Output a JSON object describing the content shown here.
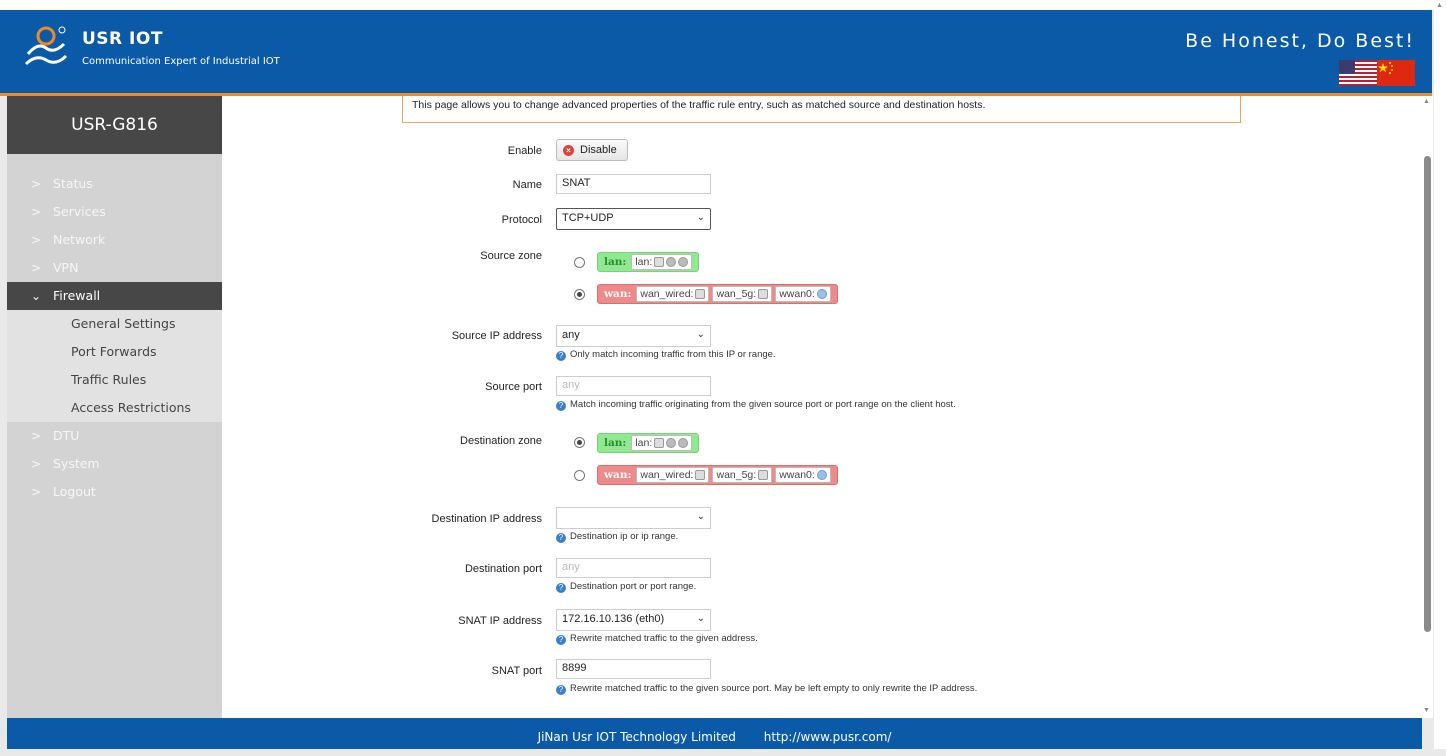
{
  "header": {
    "logo_title": "USR IOT",
    "logo_subtitle": "Communication Expert of Industrial IOT",
    "slogan": "Be Honest, Do Best!",
    "colors": {
      "header_bg": "#0a5aa8",
      "accent": "#f08a24"
    }
  },
  "sidebar": {
    "brand": "USR-G816",
    "items_top": [
      {
        "label": "Status"
      },
      {
        "label": "Services"
      },
      {
        "label": "Network"
      },
      {
        "label": "VPN"
      }
    ],
    "active": {
      "label": "Firewall"
    },
    "subitems": [
      {
        "label": "General Settings"
      },
      {
        "label": "Port Forwards"
      },
      {
        "label": "Traffic Rules"
      },
      {
        "label": "Access Restrictions"
      }
    ],
    "items_bottom": [
      {
        "label": "DTU"
      },
      {
        "label": "System"
      },
      {
        "label": "Logout"
      }
    ]
  },
  "main": {
    "description": "This page allows you to change advanced properties of the traffic rule entry, such as matched source and destination hosts.",
    "enable": {
      "label": "Enable",
      "button": "Disable"
    },
    "name": {
      "label": "Name",
      "value": "SNAT"
    },
    "protocol": {
      "label": "Protocol",
      "value": "TCP+UDP"
    },
    "source_zone": {
      "label": "Source zone",
      "lan": {
        "name": "lan:",
        "iface": "lan:"
      },
      "wan": {
        "name": "wan:",
        "iface1": "wan_wired:",
        "iface2": "wan_5g:",
        "iface3": "wwan0:"
      },
      "selected": "wan"
    },
    "source_ip": {
      "label": "Source IP address",
      "value": "any",
      "hint": "Only match incoming traffic from this IP or range."
    },
    "source_port": {
      "label": "Source port",
      "placeholder": "any",
      "hint": "Match incoming traffic originating from the given source port or port range on the client host."
    },
    "dest_zone": {
      "label": "Destination zone",
      "lan": {
        "name": "lan:",
        "iface": "lan:"
      },
      "wan": {
        "name": "wan:",
        "iface1": "wan_wired:",
        "iface2": "wan_5g:",
        "iface3": "wwan0:"
      },
      "selected": "lan"
    },
    "dest_ip": {
      "label": "Destination IP address",
      "value": "",
      "hint": "Destination ip or ip range."
    },
    "dest_port": {
      "label": "Destination port",
      "placeholder": "any",
      "hint": "Destination port or port range."
    },
    "snat_ip": {
      "label": "SNAT IP address",
      "value": "172.16.10.136 (eth0)",
      "hint": "Rewrite matched traffic to the given address."
    },
    "snat_port": {
      "label": "SNAT port",
      "value": "8899",
      "hint": "Rewrite matched traffic to the given source port. May be left empty to only rewrite the IP address."
    }
  },
  "footer": {
    "company": "JiNan Usr IOT Technology Limited",
    "url": "http://www.pusr.com/"
  }
}
